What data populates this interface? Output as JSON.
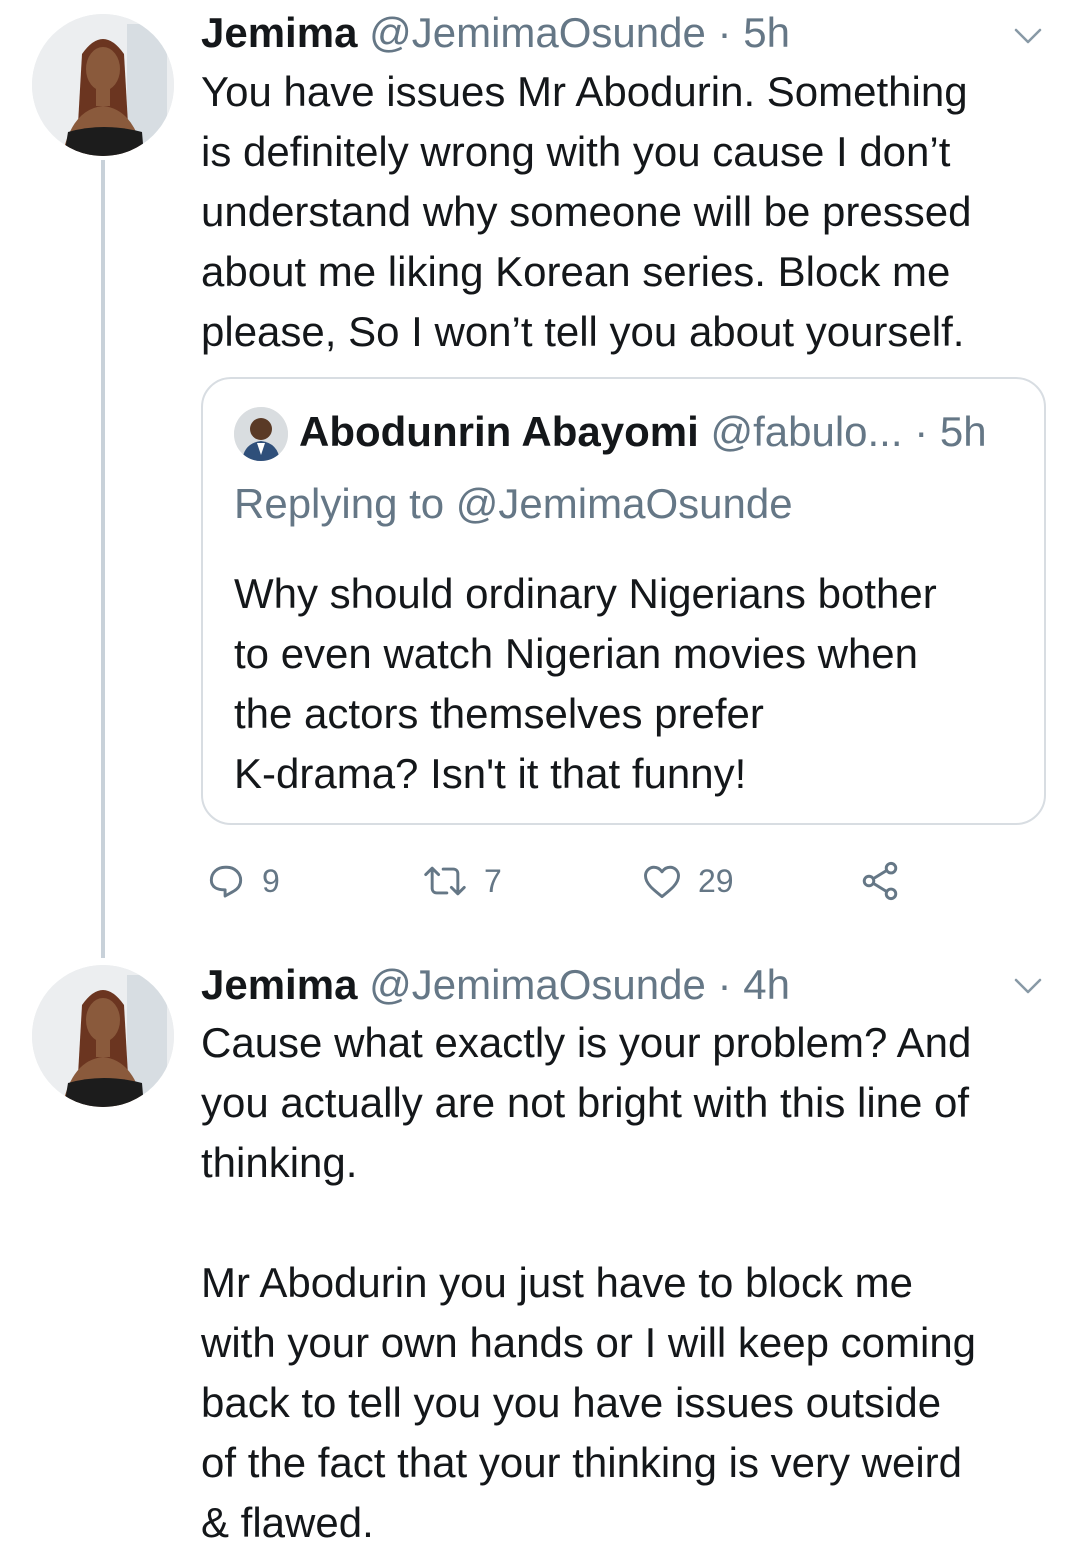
{
  "tweets": [
    {
      "name": "Jemima",
      "handle": "@JemimaOsunde",
      "separator": "·",
      "time": "5h",
      "text": "You have issues Mr Abodurin. Something\nis definitely wrong with you cause I don’t\nunderstand why someone will be pressed\nabout me liking Korean series. Block me\nplease, So I won’t tell you about yourself.",
      "quote": {
        "name": "Abodunrin Abayomi",
        "handle": "@fabulo...",
        "separator": "·",
        "time": "5h",
        "replying_to": "Replying to @JemimaOsunde",
        "text": "Why should ordinary Nigerians bother\nto even watch Nigerian movies when\nthe actors themselves prefer\nK-drama? Isn't it that funny!"
      },
      "actions": {
        "replies": "9",
        "retweets": "7",
        "likes": "29"
      }
    },
    {
      "name": "Jemima",
      "handle": "@JemimaOsunde",
      "separator": "·",
      "time": "4h",
      "text": "Cause what exactly is your problem? And\nyou actually are not bright with this line of\nthinking.\n\nMr Abodurin you just have to block me\nwith your own hands or I will keep coming\nback to tell you you have issues outside\nof the fact that your thinking is very weird\n& flawed."
    }
  ],
  "icons": {
    "reply": "reply-icon",
    "retweet": "retweet-icon",
    "like": "heart-icon",
    "share": "share-icon",
    "menu": "chevron-down-icon"
  },
  "colors": {
    "text": "#14171a",
    "secondary": "#657786",
    "thread_line": "#c8d1d9",
    "border": "#d8dde2"
  }
}
